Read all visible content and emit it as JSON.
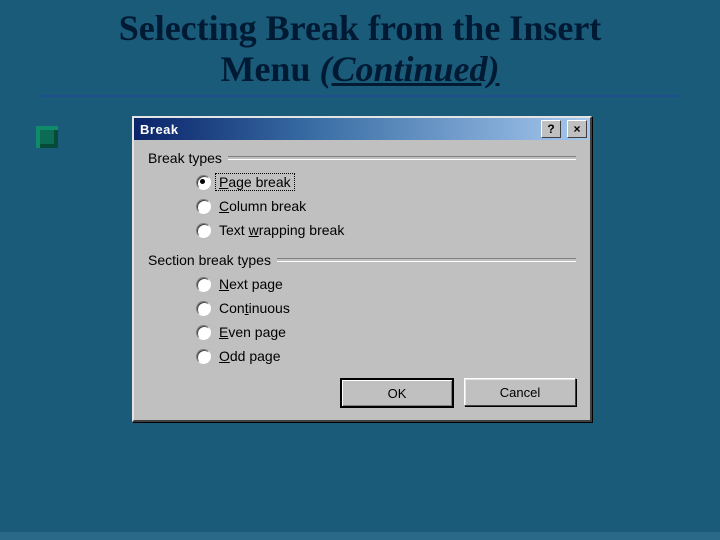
{
  "slide": {
    "title_line1": "Selecting Break from the Insert",
    "title_line2_a": "Menu ",
    "title_line2_b": "(Continued)"
  },
  "dialog": {
    "title": "Break",
    "help_glyph": "?",
    "close_glyph": "×",
    "group_break_types": "Break types",
    "group_section_types": "Section break types",
    "radios_break": [
      {
        "label_pre": "",
        "label_u": "P",
        "label_post": "age break",
        "checked": true
      },
      {
        "label_pre": "",
        "label_u": "C",
        "label_post": "olumn break",
        "checked": false
      },
      {
        "label_pre": "Text ",
        "label_u": "w",
        "label_post": "rapping break",
        "checked": false
      }
    ],
    "radios_section": [
      {
        "label_pre": "",
        "label_u": "N",
        "label_post": "ext page",
        "checked": false
      },
      {
        "label_pre": "Con",
        "label_u": "t",
        "label_post": "inuous",
        "checked": false
      },
      {
        "label_pre": "",
        "label_u": "E",
        "label_post": "ven page",
        "checked": false
      },
      {
        "label_pre": "",
        "label_u": "O",
        "label_post": "dd page",
        "checked": false
      }
    ],
    "ok_label": "OK",
    "cancel_label": "Cancel"
  }
}
